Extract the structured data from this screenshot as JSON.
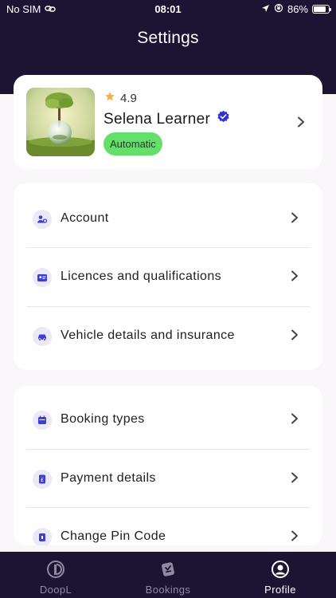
{
  "status_bar": {
    "carrier": "No SIM",
    "time": "08:01",
    "battery": "86%",
    "battery_level": 0.86
  },
  "header": {
    "title": "Settings"
  },
  "profile": {
    "rating": "4.9",
    "name": "Selena Learner",
    "badge": "Automatic",
    "avatar_icon": "crystal-ball-tree-photo",
    "verified_icon": "verified-check-icon"
  },
  "menu_group_1": [
    {
      "label": "Account",
      "icon": "account-settings-icon"
    },
    {
      "label": "Licences and qualifications",
      "icon": "id-card-icon"
    },
    {
      "label": "Vehicle details and insurance",
      "icon": "car-icon"
    }
  ],
  "menu_group_2": [
    {
      "label": "Booking types",
      "icon": "calendar-icon"
    },
    {
      "label": "Payment details",
      "icon": "payment-icon"
    },
    {
      "label": "Change Pin Code",
      "icon": "lock-icon"
    }
  ],
  "tabs": [
    {
      "label": "DoopL",
      "icon": "doopl-logo-icon",
      "active": false
    },
    {
      "label": "Bookings",
      "icon": "bookings-icon",
      "active": false
    },
    {
      "label": "Profile",
      "icon": "profile-icon",
      "active": true
    }
  ],
  "colors": {
    "header_bg": "#1b1433",
    "badge_bg": "#63df6a",
    "accent": "#3b3fd6",
    "icon_bg": "#ece8f8"
  }
}
